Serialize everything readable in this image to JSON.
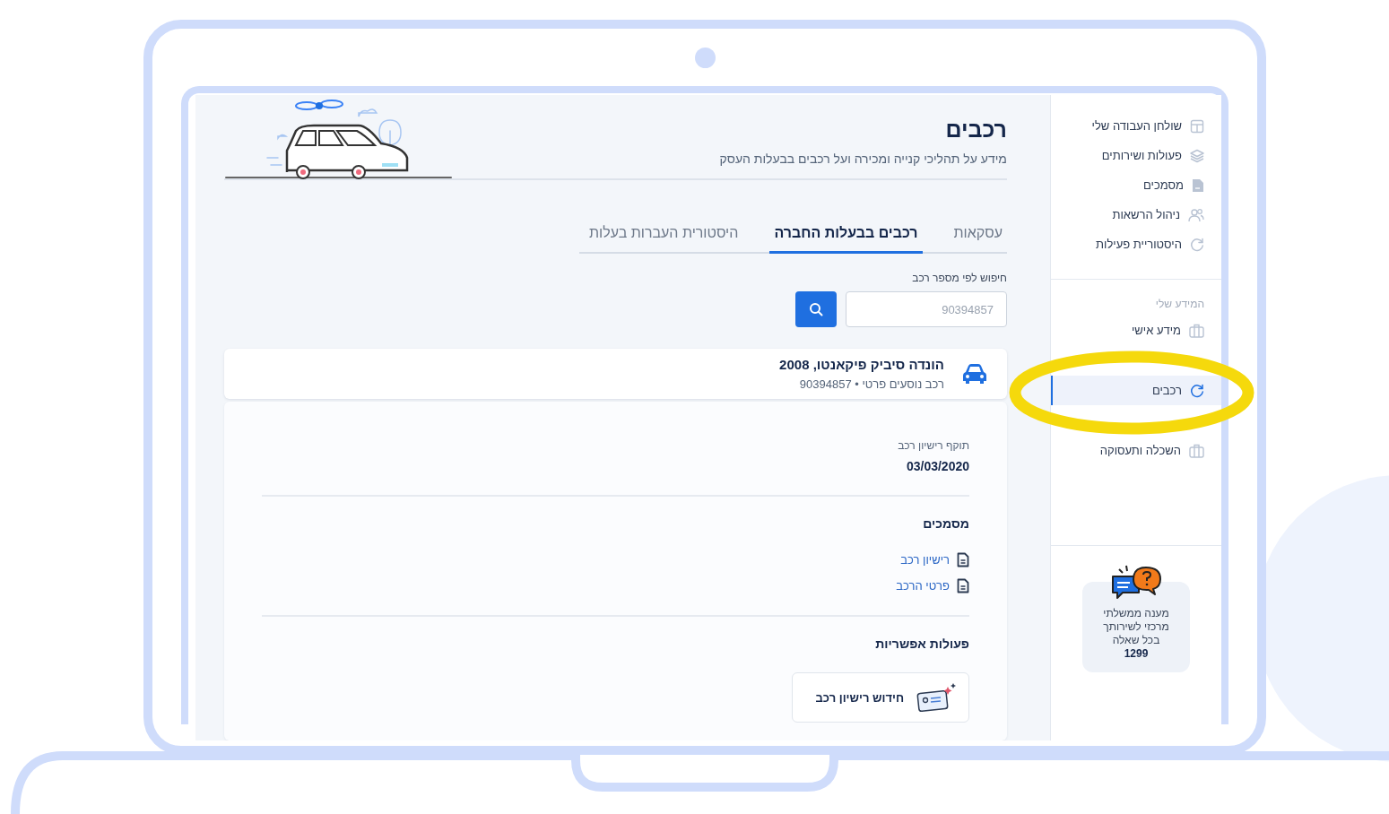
{
  "page": {
    "title": "רכבים",
    "subtitle": "מידע על תהליכי קנייה ומכירה ועל רכבים בבעלות העסק"
  },
  "tabs": [
    {
      "label": "עסקאות",
      "selected": false
    },
    {
      "label": "רכבים בבעלות החברה",
      "selected": true
    },
    {
      "label": "היסטורית העברות בעלות",
      "selected": false
    }
  ],
  "search": {
    "label": "חיפוש לפי מספר רכב",
    "placeholder": "90394857"
  },
  "vehicle": {
    "name": "הונדה סיביק פיקאנטו, 2008",
    "details": "רכב נוסעים פרטי • 90394857"
  },
  "license": {
    "label": "תוקף רישיון רכב",
    "value": "03/03/2020"
  },
  "documents": {
    "heading": "מסמכים",
    "items": [
      "רישיון רכב",
      "פרטי הרכב"
    ]
  },
  "actions": {
    "heading": "פעולות אפשריות",
    "items": [
      "חידוש רישיון רכב"
    ]
  },
  "sidebar": {
    "main_items": [
      {
        "label": "שולחן העבודה שלי",
        "selected": false
      },
      {
        "label": "פעולות ושירותים",
        "selected": false
      },
      {
        "label": "מסמכים",
        "selected": false
      },
      {
        "label": "ניהול הרשאות",
        "selected": false
      },
      {
        "label": "היסטוריית פעילות",
        "selected": false
      }
    ],
    "section": {
      "heading": "המידע שלי",
      "items": [
        {
          "label": "מידע אישי",
          "selected": false
        },
        {
          "label": "רכבים",
          "selected": true
        },
        {
          "label": "השכלה ותעסוקה",
          "selected": false
        }
      ]
    }
  },
  "help_card": {
    "lines": [
      "מענה ממשלתי",
      "מרכזי לשירותך",
      "בכל שאלה"
    ],
    "phone": "1299"
  }
}
